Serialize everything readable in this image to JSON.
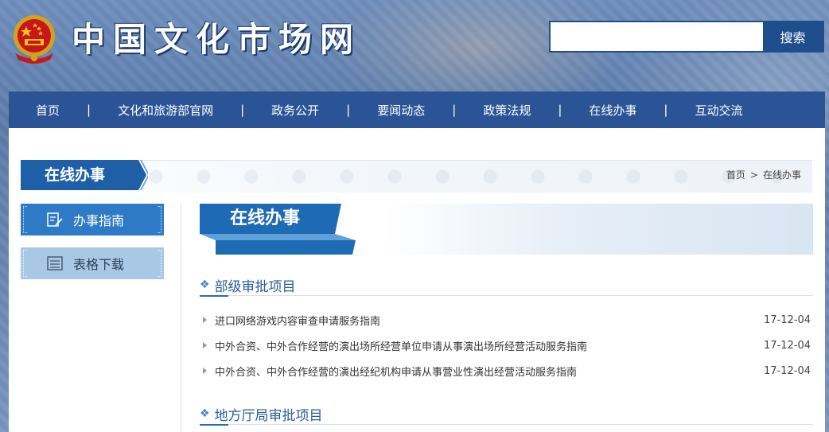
{
  "header": {
    "site_title": "中国文化市场网",
    "search": {
      "placeholder": "",
      "value": "",
      "button_label": "搜索"
    }
  },
  "nav": {
    "items": [
      {
        "label": "首页"
      },
      {
        "label": "文化和旅游部官网"
      },
      {
        "label": "政务公开"
      },
      {
        "label": "要闻动态"
      },
      {
        "label": "政策法规"
      },
      {
        "label": "在线办事"
      },
      {
        "label": "互动交流"
      }
    ],
    "separator": "|"
  },
  "section": {
    "tab_label": "在线办事",
    "breadcrumb": {
      "home": "首页",
      "sep": ">",
      "current": "在线办事"
    }
  },
  "sidebar": {
    "items": [
      {
        "label": "办事指南",
        "icon": "edit-doc-icon",
        "active": true
      },
      {
        "label": "表格下载",
        "icon": "form-list-icon",
        "active": false
      }
    ]
  },
  "main": {
    "banner_title": "在线办事",
    "categories": [
      {
        "title": "部级审批项目",
        "items": [
          {
            "title": "进口网络游戏内容审查申请服务指南",
            "date": "17-12-04"
          },
          {
            "title": "中外合资、中外合作经营的演出场所经营单位申请从事演出场所经营活动服务指南",
            "date": "17-12-04"
          },
          {
            "title": "中外合资、中外合作经营的演出经纪机构申请从事营业性演出经营活动服务指南",
            "date": "17-12-04"
          }
        ]
      },
      {
        "title": "地方厅局审批项目",
        "items": []
      }
    ]
  },
  "colors": {
    "nav_bg": "#2a5496",
    "accent_blue": "#2f7ac6",
    "sidebar_inactive": "#a9c8e6",
    "category_text": "#2a5c98"
  }
}
